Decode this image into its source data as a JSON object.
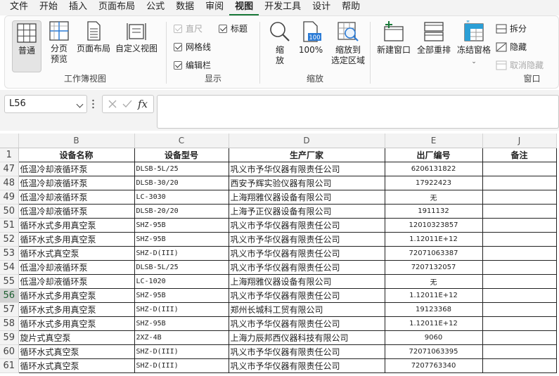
{
  "menu": {
    "tabs": [
      "文件",
      "开始",
      "插入",
      "页面布局",
      "公式",
      "数据",
      "审阅",
      "视图",
      "开发工具",
      "设计",
      "帮助"
    ],
    "active_tab": "视图"
  },
  "ribbon": {
    "workbook_views": {
      "label": "工作簿视图",
      "normal": "普通",
      "page_break_line1": "分页",
      "page_break_line2": "预览",
      "page_layout": "页面布局",
      "custom_views": "自定义视图"
    },
    "show": {
      "label": "显示",
      "ruler": "直尺",
      "formula_bar": "标题",
      "gridlines": "网格线",
      "headings": "编辑栏"
    },
    "zoom": {
      "label": "缩放",
      "zoom_line1": "缩",
      "zoom_line2": "放",
      "zoom_100_badge": "100",
      "zoom_100": "100%",
      "zoom_sel_line1": "缩放到",
      "zoom_sel_line2": "选定区域"
    },
    "window": {
      "label": "窗口",
      "new_window": "新建窗口",
      "arrange_all": "全部重排",
      "freeze_panes": "冻结窗格",
      "split": "拆分",
      "hide": "隐藏",
      "unhide": "取消隐藏"
    }
  },
  "formula_bar": {
    "name_box": "L56",
    "fx_label": "fx",
    "formula": ""
  },
  "grid": {
    "columns": [
      "B",
      "C",
      "D",
      "E",
      "J"
    ],
    "header_row": {
      "row": "1",
      "cells": [
        "设备名称",
        "设备型号",
        "生产厂家",
        "出厂编号",
        "备注"
      ]
    },
    "selected_row": "56",
    "rows": [
      {
        "row": "47",
        "cells": [
          "低温冷却液循环泵",
          "DLSB-5L/25",
          "巩义市予华仪器有限责任公司",
          "6206131822",
          ""
        ]
      },
      {
        "row": "48",
        "cells": [
          "低温冷却液循环泵",
          "DLSB-30/20",
          "西安予辉实验仪器有限公司",
          "17922423",
          ""
        ]
      },
      {
        "row": "49",
        "cells": [
          "低温冷却液循环泵",
          "LC-3030",
          "上海翔雅仪器设备有限公司",
          "无",
          ""
        ]
      },
      {
        "row": "50",
        "cells": [
          "低温冷却液循环泵",
          "DLSB-20/20",
          "上海予正仪器设备有限公司",
          "1911132",
          ""
        ]
      },
      {
        "row": "51",
        "cells": [
          "循环水式多用真空泵",
          "SHZ-95B",
          "巩义市予华仪器有限责任公司",
          "12010323857",
          ""
        ]
      },
      {
        "row": "52",
        "cells": [
          "循环水式多用真空泵",
          "SHZ-95B",
          "巩义市予华仪器有限责任公司",
          "1.12011E+12",
          ""
        ]
      },
      {
        "row": "53",
        "cells": [
          "循环水式真空泵",
          "SHZ-D(III)",
          "巩义市予华仪器有限责任公司",
          "72071063387",
          ""
        ]
      },
      {
        "row": "54",
        "cells": [
          "低温冷却液循环泵",
          "DLSB-5L/25",
          "巩义市予华仪器有限责任公司",
          "7207132057",
          ""
        ]
      },
      {
        "row": "55",
        "cells": [
          "低温冷却液循环泵",
          "LC-1020",
          "上海翔雅仪器设备有限公司",
          "无",
          ""
        ]
      },
      {
        "row": "56",
        "cells": [
          "循环水式多用真空泵",
          "SHZ-95B",
          "巩义市予华仪器有限责任公司",
          "1.12011E+12",
          ""
        ]
      },
      {
        "row": "57",
        "cells": [
          "循环水式多用真空泵",
          "SHZ-D(III)",
          "郑州长城科工贸有限公司",
          "19123368",
          ""
        ]
      },
      {
        "row": "58",
        "cells": [
          "循环水式多用真空泵",
          "SHZ-95B",
          "巩义市予华仪器有限责任公司",
          "1.12011E+12",
          ""
        ]
      },
      {
        "row": "59",
        "cells": [
          "旋片式真空泵",
          "2XZ-4B",
          "上海力辰邦西仪器科技有限公司",
          "9060",
          ""
        ]
      },
      {
        "row": "60",
        "cells": [
          "循环水式真空泵",
          "SHZ-D(III)",
          "巩义市予华仪器有限责任公司",
          "72071063395",
          ""
        ]
      },
      {
        "row": "61",
        "cells": [
          "循环水式真空泵",
          "SHZ-D(III)",
          "巩义市予华仪器有限责任公司",
          "7207763340",
          ""
        ]
      }
    ]
  },
  "colors": {
    "accent": "#1a7a3a",
    "ribbon_bg": "#fbfbfb",
    "chrome_bg": "#f3f3f3",
    "freeze_icon": "#2b9fd6"
  }
}
